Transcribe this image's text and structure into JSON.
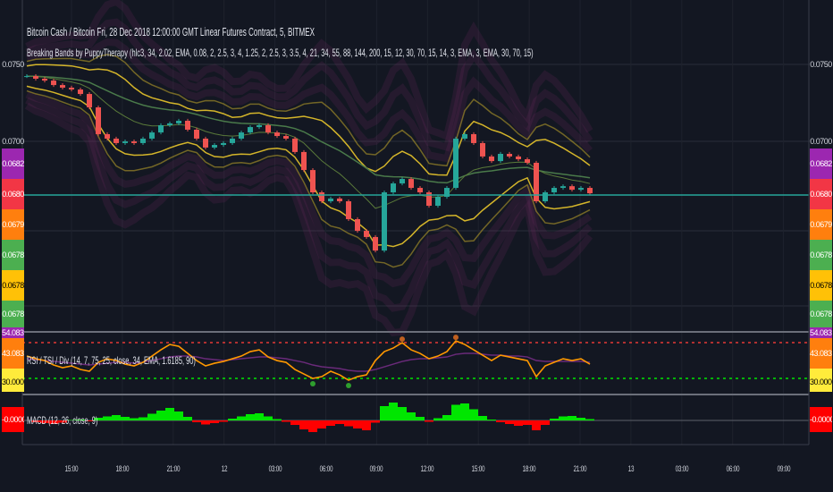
{
  "header": {
    "symbol_line": "Bitcoin Cash / Bitcoin Fri, 28 Dec 2018 12:00:00 GMT Linear Futures Contract, 5, BITMEX",
    "indicator_line": "Breaking Bands by PuppyTherapy (hlc3, 34, 2.02, EMA, 0.08, 2, 2.5, 3, 4, 1.25, 2, 2.5, 3, 3.5, 4, 21, 34, 55, 88, 144, 200, 15, 12, 30, 70, 15, 14, 3, EMA, 3, EMA, 30, 70, 15)"
  },
  "rsi_pane": {
    "label": "RSI / TSI / Div (14, 7, 75, 25, close, 34, EMA, 1.6185, 90)",
    "value": "43.0832",
    "top_label": "54.0832",
    "bottom_label": "30.0000"
  },
  "macd_pane": {
    "label": "MACD (12, 26, close, 9)",
    "value": "-0.0000"
  },
  "price_axis": {
    "ticks": [
      "0.0750",
      "0.0700"
    ],
    "badges": [
      {
        "text": "0.0682",
        "color": "#9c27b0"
      },
      {
        "text": "0.0680",
        "color": "#f23645"
      },
      {
        "text": "0.0679",
        "color": "#ff7f0e"
      },
      {
        "text": "0.0678",
        "color": "#4caf50"
      },
      {
        "text": "0.0678",
        "color": "#ffc107"
      },
      {
        "text": "0.0678",
        "color": "#4caf50"
      }
    ]
  },
  "time_axis": [
    "15:00",
    "18:00",
    "21:00",
    "12",
    "03:00",
    "06:00",
    "09:00",
    "12:00",
    "15:00",
    "18:00",
    "21:00",
    "13",
    "03:00",
    "06:00",
    "09:00"
  ],
  "colors": {
    "background": "#131722",
    "band": "#d4b52a",
    "ma": "#4a7a4a",
    "up": "#26a69a",
    "down": "#ef5350",
    "last_price": "#26a69a",
    "rsi": "#ff9800",
    "rsi_upper": "#e53935",
    "rsi_lower": "#00e600",
    "macd_up": "#00e600",
    "macd_down": "#ff0000"
  },
  "chart_data": {
    "type": "line",
    "title": "Bitcoin Cash / Bitcoin, 5, BITMEX",
    "ylim": [
      0.0627,
      0.0757
    ],
    "close": [
      0.07424,
      0.07407,
      0.07395,
      0.07366,
      0.07349,
      0.07337,
      0.07308,
      0.07221,
      0.07047,
      0.07018,
      0.06989,
      0.07,
      0.06989,
      0.07018,
      0.07058,
      0.07105,
      0.07117,
      0.07134,
      0.07076,
      0.07018,
      0.0696,
      0.06977,
      0.06989,
      0.07018,
      0.07058,
      0.07093,
      0.07105,
      0.07058,
      0.07035,
      0.07018,
      0.06931,
      0.06814,
      0.06669,
      0.06611,
      0.06629,
      0.06611,
      0.06495,
      0.06419,
      0.06379,
      0.06291,
      0.06669,
      0.06727,
      0.06756,
      0.06698,
      0.06669,
      0.06582,
      0.0664,
      0.06698,
      0.07018,
      0.07047,
      0.06989,
      0.06902,
      0.06872,
      0.06919,
      0.06902,
      0.06884,
      0.06861,
      0.06611,
      0.06669,
      0.06698,
      0.06709,
      0.06686,
      0.06698,
      0.06663
    ],
    "last_price": 0.0665,
    "rsi": {
      "ylim": [
        0,
        100
      ],
      "upper": 70,
      "lower": 30,
      "values": [
        55,
        52,
        50,
        45,
        42,
        44,
        40,
        38,
        48,
        52,
        50,
        46,
        44,
        48,
        55,
        62,
        68,
        66,
        58,
        50,
        44,
        47,
        49,
        52,
        55,
        60,
        62,
        54,
        50,
        48,
        40,
        35,
        30,
        32,
        38,
        34,
        28,
        32,
        34,
        50,
        60,
        64,
        70,
        62,
        58,
        52,
        55,
        60,
        72,
        68,
        62,
        56,
        50,
        56,
        54,
        52,
        50,
        32,
        44,
        48,
        52,
        50,
        52,
        46
      ],
      "signal": [
        52,
        51,
        50,
        49,
        48,
        47,
        46,
        45,
        46,
        47,
        48,
        48,
        47,
        48,
        50,
        52,
        54,
        55,
        55,
        54,
        52,
        51,
        50,
        51,
        52,
        53,
        54,
        54,
        53,
        52,
        50,
        48,
        45,
        43,
        42,
        41,
        39,
        38,
        38,
        40,
        43,
        46,
        49,
        51,
        52,
        52,
        53,
        54,
        57,
        58,
        58,
        57,
        56,
        56,
        55,
        55,
        54,
        50,
        49,
        49,
        49,
        49,
        49,
        48
      ]
    },
    "macd": {
      "zero": 0,
      "histogram": [
        0,
        -0.4,
        -0.6,
        -0.8,
        -0.5,
        0.1,
        0.2,
        -0.2,
        0.6,
        0.9,
        1.2,
        0.8,
        0.5,
        0.7,
        1.5,
        2.2,
        2.8,
        2.0,
        0.8,
        -0.4,
        -0.9,
        -0.6,
        -0.3,
        0.4,
        0.9,
        1.4,
        1.6,
        0.9,
        0.3,
        -0.3,
        -1.0,
        -2.0,
        -2.6,
        -1.8,
        -1.2,
        -0.8,
        -1.3,
        -1.8,
        -2.2,
        -0.5,
        3.2,
        4.0,
        3.0,
        1.8,
        0.8,
        -0.3,
        0.5,
        1.2,
        3.5,
        3.8,
        2.5,
        1.0,
        0.2,
        -0.4,
        -0.8,
        -1.2,
        -1.0,
        -2.2,
        -1.0,
        0.4,
        0.9,
        1.0,
        0.6,
        0.3
      ]
    }
  }
}
